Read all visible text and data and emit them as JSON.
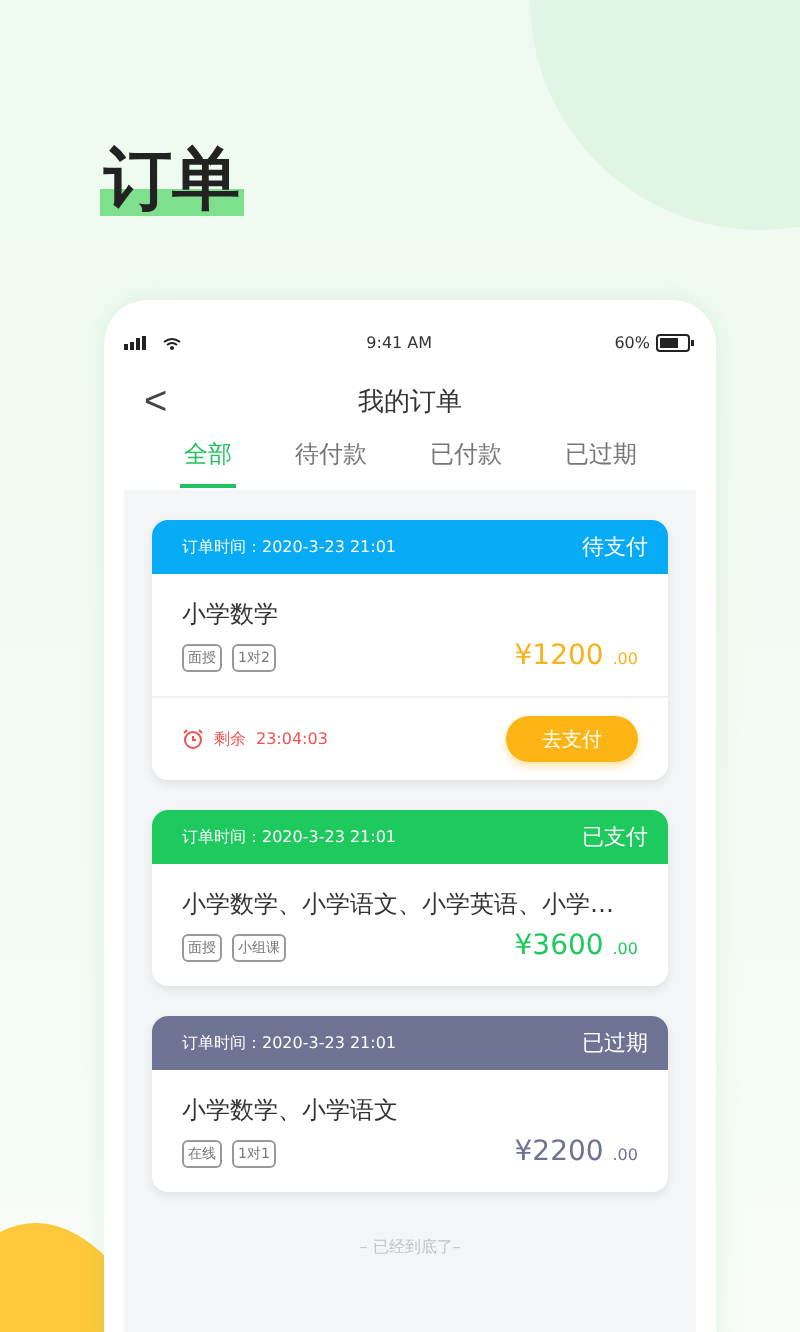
{
  "heading": "订单",
  "status_bar": {
    "time": "9:41 AM",
    "battery": "60%"
  },
  "nav": {
    "back": "<",
    "title": "我的订单"
  },
  "tabs": [
    {
      "label": "全部",
      "selected": true
    },
    {
      "label": "待付款",
      "selected": false
    },
    {
      "label": "已付款",
      "selected": false
    },
    {
      "label": "已过期",
      "selected": false
    }
  ],
  "orders": [
    {
      "kind": "pending",
      "time": "订单时间：2020-3-23  21:01",
      "status": "待支付",
      "title": "小学数学",
      "tags": [
        "面授",
        "1对2"
      ],
      "price": "¥1200",
      "cents": ".00",
      "countdown": {
        "label": "剩余",
        "value": "23:04:03"
      },
      "action": "去支付"
    },
    {
      "kind": "paid",
      "time": "订单时间：2020-3-23  21:01",
      "status": "已支付",
      "title": "小学数学、小学语文、小学英语、小学…",
      "tags": [
        "面授",
        "小组课"
      ],
      "price": "¥3600",
      "cents": ".00"
    },
    {
      "kind": "expired",
      "time": "订单时间：2020-3-23  21:01",
      "status": "已过期",
      "title": "小学数学、小学语文",
      "tags": [
        "在线",
        "1对1"
      ],
      "price": "¥2200",
      "cents": ".00"
    }
  ],
  "footer": "– 已经到底了–"
}
